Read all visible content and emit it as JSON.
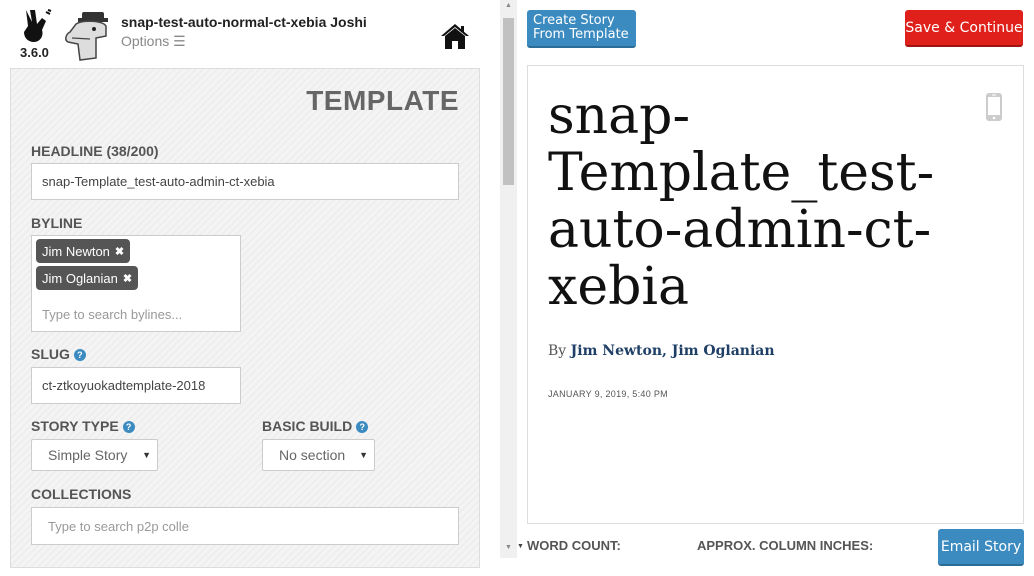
{
  "app": {
    "version": "3.6.0",
    "user_name": "snap-test-auto-normal-ct-xebia Joshi",
    "options_label": "Options ☰",
    "logo_icon": "peace-hand-icon",
    "avatar_icon": "dinosaur-icon",
    "home_icon": "home-icon"
  },
  "form": {
    "title": "TEMPLATE",
    "headline": {
      "label": "HEADLINE (38/200)",
      "value": "snap-Template_test-auto-admin-ct-xebia"
    },
    "byline": {
      "label": "BYLINE",
      "chips": [
        "Jim Newton",
        "Jim Oglanian"
      ],
      "chip_remove": "✖",
      "placeholder": "Type to search bylines..."
    },
    "slug": {
      "label": "SLUG",
      "help": "?",
      "value": "ct-ztkoyuokadtemplate-2018"
    },
    "story_type": {
      "label": "STORY TYPE",
      "help": "?",
      "selected": "Simple Story"
    },
    "basic_build": {
      "label": "BASIC BUILD",
      "help": "?",
      "selected": "No section"
    },
    "collections": {
      "label": "COLLECTIONS",
      "placeholder": "Type to search p2p colle"
    }
  },
  "toolbar": {
    "template_button": "Create Story From Template",
    "save_button": "Save & Continue"
  },
  "preview": {
    "headline": "snap-Template_test-auto-admin-ct-xebia",
    "by_prefix": "By ",
    "byline_names": "Jim Newton, Jim Oglanian",
    "date": "JANUARY 9, 2019, 5:40 PM"
  },
  "footer": {
    "word_count_label": "WORD COUNT:",
    "column_inches_label": "APPROX. COLUMN INCHES:",
    "email_button": "Email Story"
  },
  "colors": {
    "accent": "#3b8bc1",
    "danger": "#e0211b",
    "byline": "#1f3f66"
  }
}
